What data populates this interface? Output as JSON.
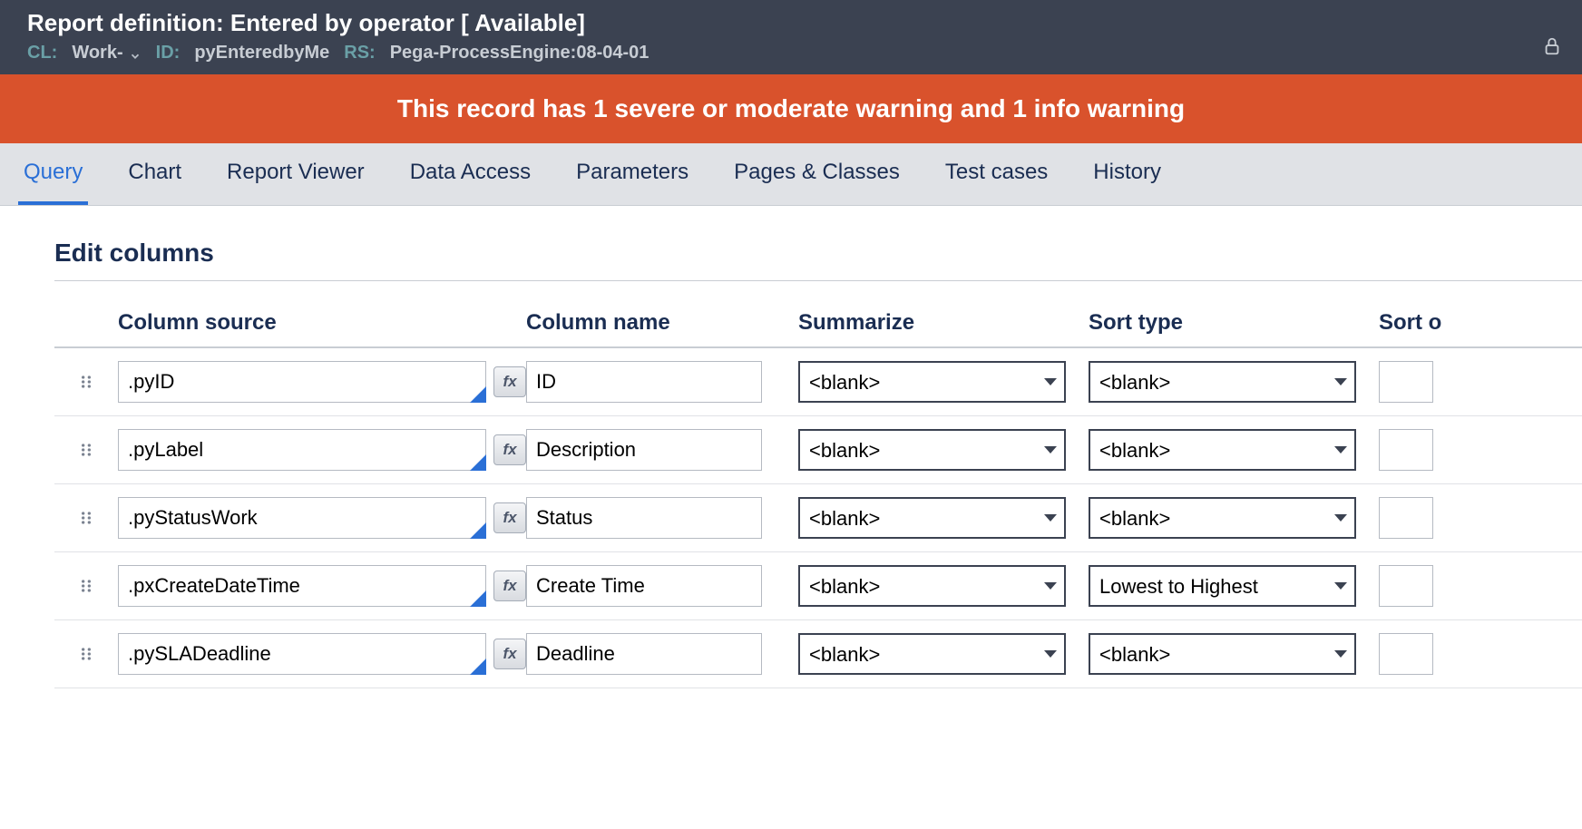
{
  "header": {
    "title_prefix": "Report definition:",
    "title_name": "Entered by operator",
    "title_status": "[ Available]",
    "cl_label": "CL:",
    "cl_value": "Work-",
    "id_label": "ID:",
    "id_value": "pyEnteredbyMe",
    "rs_label": "RS:",
    "rs_value": "Pega-ProcessEngine:08-04-01"
  },
  "banner": "This record has 1 severe or moderate warning and 1 info warning",
  "tabs": [
    "Query",
    "Chart",
    "Report Viewer",
    "Data Access",
    "Parameters",
    "Pages & Classes",
    "Test cases",
    "History"
  ],
  "active_tab": 0,
  "panel": {
    "title": "Edit columns",
    "columns": [
      "Column source",
      "Column name",
      "Summarize",
      "Sort type",
      "Sort o"
    ]
  },
  "rows": [
    {
      "source": ".pyID",
      "name": "ID",
      "summarize": "<blank>",
      "sort": "<blank>"
    },
    {
      "source": ".pyLabel",
      "name": "Description",
      "summarize": "<blank>",
      "sort": "<blank>"
    },
    {
      "source": ".pyStatusWork",
      "name": "Status",
      "summarize": "<blank>",
      "sort": "<blank>"
    },
    {
      "source": ".pxCreateDateTime",
      "name": "Create Time",
      "summarize": "<blank>",
      "sort": "Lowest to Highest"
    },
    {
      "source": ".pySLADeadline",
      "name": "Deadline",
      "summarize": "<blank>",
      "sort": "<blank>"
    }
  ],
  "fx_label": "fx"
}
